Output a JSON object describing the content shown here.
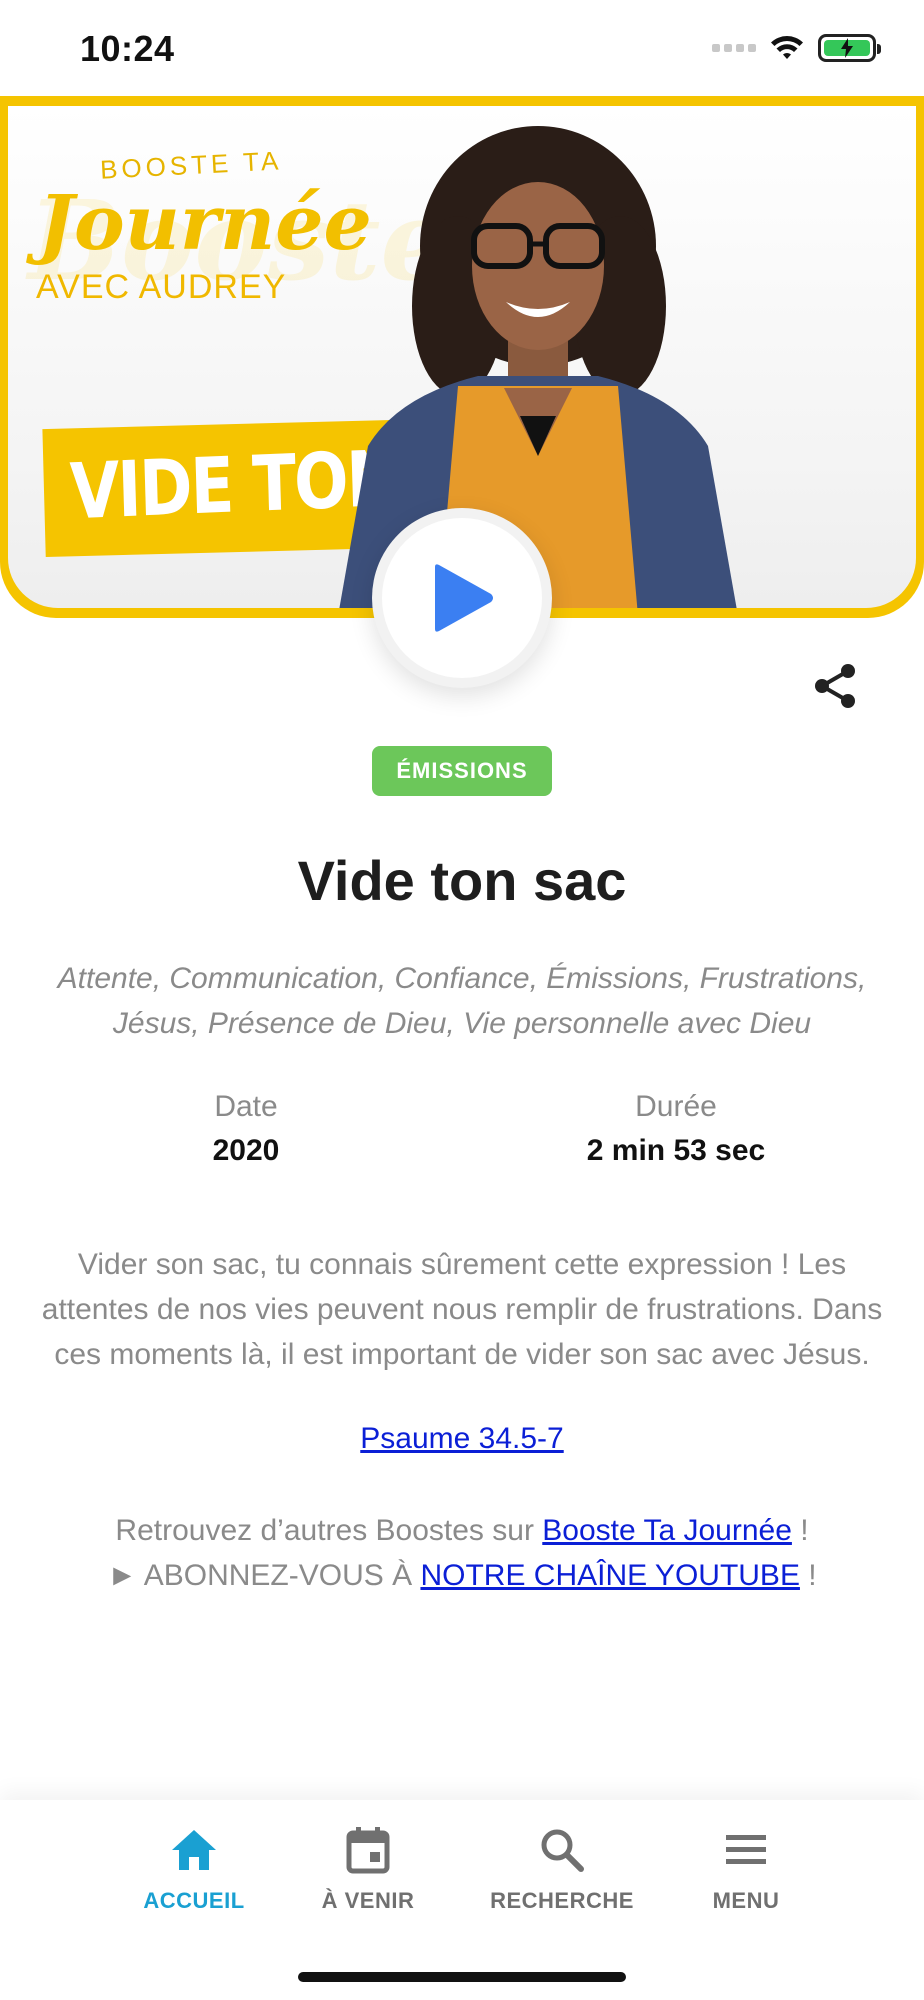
{
  "status_bar": {
    "time": "10:24"
  },
  "hero": {
    "brand_top": "BOOSTE TA",
    "brand_main": "Journée",
    "brand_sub": "AVEC AUDREY",
    "banner_text": "VIDE TON SAC",
    "accent_color": "#f5c400"
  },
  "episode": {
    "category": "ÉMISSIONS",
    "title": "Vide ton sac",
    "tags": "Attente, Communication, Confiance, Émissions, Frustrations, Jésus, Présence de Dieu, Vie personnelle avec Dieu",
    "date_label": "Date",
    "date_value": "2020",
    "duration_label": "Durée",
    "duration_value": "2 min 53 sec",
    "description": "Vider son sac, tu connais sûrement cette expression ! Les attentes de nos vies peuvent nous remplir de frustrations. Dans ces moments là, il est important de vider son sac avec Jésus.",
    "scripture_link": "Psaume 34.5-7"
  },
  "footer": {
    "line1_prefix": "Retrouvez d’autres Boostes sur ",
    "line1_link": "Booste Ta Journée",
    "line1_suffix": " !",
    "line2_prefix": "► ABONNEZ-VOUS À ",
    "line2_link": "NOTRE CHAÎNE YOUTUBE",
    "line2_suffix": " !"
  },
  "nav": {
    "home": "ACCUEIL",
    "upcoming": "À VENIR",
    "search": "RECHERCHE",
    "menu": "MENU",
    "active_color": "#1aa0d2"
  }
}
